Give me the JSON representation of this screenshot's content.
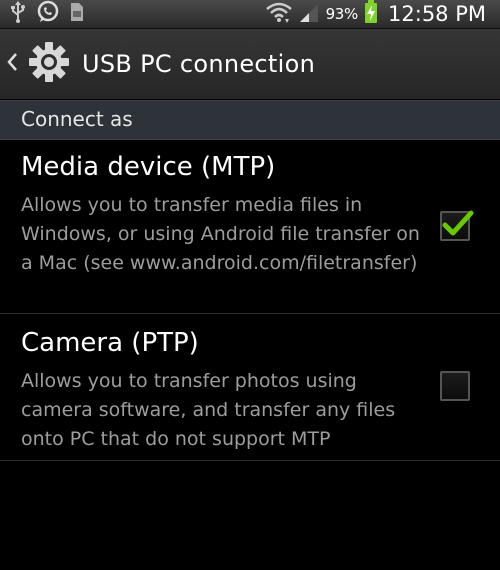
{
  "status_bar": {
    "battery_percent": "93%",
    "time": "12:58 PM",
    "icons": [
      "usb-icon",
      "whatsapp-icon",
      "sd-card-icon",
      "wifi-icon",
      "signal-icon",
      "battery-charging-icon"
    ]
  },
  "action_bar": {
    "title": "USB PC connection"
  },
  "category": {
    "label": "Connect as"
  },
  "options": [
    {
      "title": "Media device (MTP)",
      "summary": "Allows you to transfer media files in Windows, or using Android file transfer on a Mac (see www.android.com/filetransfer)",
      "checked": true
    },
    {
      "title": "Camera (PTP)",
      "summary": "Allows you to transfer photos using camera software, and transfer any files onto PC that do not support MTP",
      "checked": false
    }
  ],
  "colors": {
    "check_accent": "#6bc800",
    "category_bg": "#2e3339",
    "summary_text": "#9d9d9d"
  }
}
